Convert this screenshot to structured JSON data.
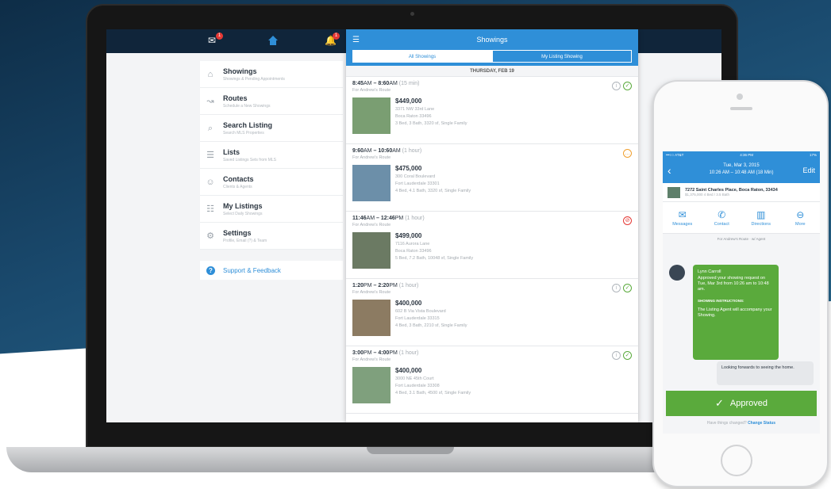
{
  "colors": {
    "accent": "#2f8fd8",
    "success": "#5aaa3c",
    "alert": "#e53935",
    "navy": "#10253a"
  },
  "laptop": {
    "top_bar": {
      "icons": [
        {
          "name": "mail-icon",
          "badge": "1"
        },
        {
          "name": "home-icon",
          "badge": ""
        },
        {
          "name": "bell-icon",
          "badge": "1"
        }
      ]
    },
    "menu": [
      {
        "title": "Showings",
        "subtitle": "Showings & Pending Appointments",
        "icon": "house-icon"
      },
      {
        "title": "Routes",
        "subtitle": "Schedule a New Showings",
        "icon": "route-icon"
      },
      {
        "title": "Search Listing",
        "subtitle": "Search MLS Properties",
        "icon": "search-icon"
      },
      {
        "title": "Lists",
        "subtitle": "Saved Listings Sets from MLS",
        "icon": "list-icon"
      },
      {
        "title": "Contacts",
        "subtitle": "Clients & Agents",
        "icon": "contact-icon"
      },
      {
        "title": "My Listings",
        "subtitle": "Select Daily Showings",
        "icon": "listings-icon"
      },
      {
        "title": "Settings",
        "subtitle": "Profile, Email (?) & Team",
        "icon": "settings-icon"
      }
    ],
    "support_label": "Support & Feedback",
    "panel": {
      "title": "Showings",
      "tabs": [
        "All Showings",
        "My Listing Showing"
      ],
      "date": "THURSDAY, FEB 19",
      "showings": [
        {
          "start": "8:45",
          "start_ampm": "AM",
          "end": "8:60",
          "end_ampm": "AM",
          "duration": "(15 min)",
          "for": "For Andrew's Route",
          "price": "$449,000",
          "address1": "3371 NW 33rd Lane",
          "address2": "Boca Raton 33496",
          "details": "3 Bed, 3 Bath, 3320 sf, Single Family",
          "status": "approved",
          "thumb": "#7a9e72"
        },
        {
          "start": "9:60",
          "start_ampm": "AM",
          "end": "10:60",
          "end_ampm": "AM",
          "duration": "(1 hour)",
          "for": "For Andrew's Route",
          "price": "$475,000",
          "address1": "300 Coral Boulevard",
          "address2": "Fort Lauderdale 33301",
          "details": "4 Bed, 4.1 Bath, 3320 sf, Single Family",
          "status": "pending",
          "thumb": "#6c8fa9"
        },
        {
          "start": "11:46",
          "start_ampm": "AM",
          "end": "12:46",
          "end_ampm": "PM",
          "duration": "(1 hour)",
          "for": "For Andrew's Route",
          "price": "$499,000",
          "address1": "7116 Aurora Lane",
          "address2": "Boca Raton 33496",
          "details": "5 Bed, 7.2 Bath, 10048 sf, Single Family",
          "status": "declined",
          "thumb": "#6b7a63"
        },
        {
          "start": "1:20",
          "start_ampm": "PM",
          "end": "2:20",
          "end_ampm": "PM",
          "duration": "(1 hour)",
          "for": "For Andrew's Route",
          "price": "$400,000",
          "address1": "602 B Via Vista Boulevard",
          "address2": "Fort Lauderdale 33315",
          "details": "4 Bed, 3 Bath, 2210 sf, Single Family",
          "status": "approved",
          "thumb": "#8c7b62"
        },
        {
          "start": "3:00",
          "start_ampm": "PM",
          "end": "4:00",
          "end_ampm": "PM",
          "duration": "(1 hour)",
          "for": "For Andrew's Route",
          "price": "$400,000",
          "address1": "3000 NE 45th Court",
          "address2": "Fort Lauderdale 33308",
          "details": "4 Bed, 3.1 Bath, 4500 sf, Single Family",
          "status": "approved",
          "thumb": "#7fa07d"
        }
      ]
    }
  },
  "phone": {
    "status_left": "•••○○ AT&T",
    "status_time": "4:36 PM",
    "status_right": "17%",
    "nav": {
      "back": "‹",
      "title_line1": "Tue, Mar 3, 2015",
      "title_line2": "10:26 AM – 10:48 AM (18 Min)",
      "edit": "Edit"
    },
    "property": {
      "address": "7272 Saint Charles Place, Boca Raton, 33434",
      "sub": "$1,375,000 4 Bed / 3.5 Bath"
    },
    "actions": [
      {
        "label": "Messages",
        "icon": "envelope-icon"
      },
      {
        "label": "Contact",
        "icon": "phone-icon"
      },
      {
        "label": "Directions",
        "icon": "map-icon"
      },
      {
        "label": "More",
        "icon": "more-icon"
      }
    ],
    "route_note": "For Andrew's Route  ·  w/ Agent",
    "message": {
      "name": "Lynn Carroll",
      "text": "Approved your showing request on Tue, Mar 3rd from 10:26 am to 10:48 am.",
      "instructions_head": "SHOWING INSTRUCTIONS:",
      "instructions": "The Listing Agent will accompany your Showing."
    },
    "reply": "Looking forwards to seeing the home.",
    "approved_label": "Approved",
    "change_prompt": "Have things changed?",
    "change_link": "Change Status"
  }
}
